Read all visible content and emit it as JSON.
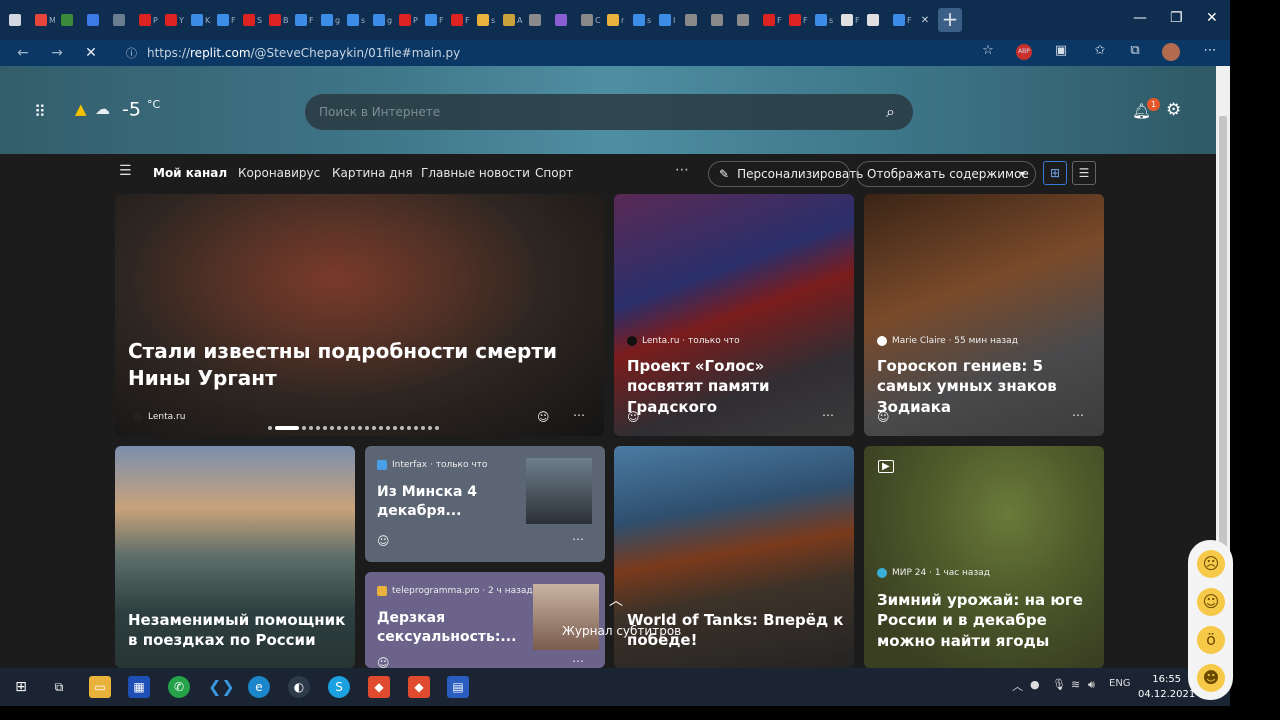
{
  "browser": {
    "tabs": [
      {
        "letter": "",
        "color": "#d0d7e0"
      },
      {
        "letter": "M",
        "color": "#e8453c"
      },
      {
        "letter": "",
        "color": "#3a8a3a"
      },
      {
        "letter": "",
        "color": "#3c7be6"
      },
      {
        "letter": "",
        "color": "#6a7d91"
      },
      {
        "letter": "P",
        "color": "#d22"
      },
      {
        "letter": "Y",
        "color": "#d22"
      },
      {
        "letter": "K",
        "color": "#3d8de8"
      },
      {
        "letter": "F",
        "color": "#3d8de8"
      },
      {
        "letter": "S",
        "color": "#d22"
      },
      {
        "letter": "B",
        "color": "#d22"
      },
      {
        "letter": "F",
        "color": "#3d8de8"
      },
      {
        "letter": "g",
        "color": "#3d8de8"
      },
      {
        "letter": "s",
        "color": "#3d8de8"
      },
      {
        "letter": "g",
        "color": "#3d8de8"
      },
      {
        "letter": "P",
        "color": "#d22"
      },
      {
        "letter": "F",
        "color": "#3d8de8"
      },
      {
        "letter": "F",
        "color": "#d22"
      },
      {
        "letter": "s",
        "color": "#e8b23c"
      },
      {
        "letter": "A",
        "color": "#c9a23c"
      },
      {
        "letter": "",
        "color": "#8a8a8a"
      },
      {
        "letter": "",
        "color": "#8b5fd1"
      },
      {
        "letter": "C",
        "color": "#8a8a8a"
      },
      {
        "letter": "r",
        "color": "#e8b23c"
      },
      {
        "letter": "s",
        "color": "#3d8de8"
      },
      {
        "letter": "I",
        "color": "#3d8de8"
      },
      {
        "letter": "",
        "color": "#8a8a8a"
      },
      {
        "letter": "",
        "color": "#8a8a8a"
      },
      {
        "letter": "",
        "color": "#8a8a8a"
      },
      {
        "letter": "F",
        "color": "#d22"
      },
      {
        "letter": "F",
        "color": "#d22"
      },
      {
        "letter": "s",
        "color": "#3d8de8"
      },
      {
        "letter": "F",
        "color": "#e0e0e0"
      },
      {
        "letter": "",
        "color": "#e0e0e0"
      },
      {
        "letter": "F",
        "color": "#3d8de8"
      }
    ],
    "url_prefix": "https://",
    "url_domain": "replit.com",
    "url_path": "/@SteveChepaykin/01file#main.py",
    "abp_label": "ABP"
  },
  "header": {
    "temperature": "-5",
    "temp_unit": "°C",
    "search_placeholder": "Поиск в Интернете",
    "notification_count": "1"
  },
  "nav": {
    "items": [
      {
        "label": "Мой канал"
      },
      {
        "label": "Коронавирус"
      },
      {
        "label": "Картина дня"
      },
      {
        "label": "Главные новости"
      },
      {
        "label": "Спорт"
      }
    ],
    "personalize_label": "Персонализировать",
    "display_label": "Отображать содержимое"
  },
  "cards": {
    "hero": {
      "title": "Стали известны подробности смерти Нины Ургант",
      "source": "Lenta.ru"
    },
    "c2": {
      "title": "Проект «Голос» посвятят памяти Градского",
      "source": "Lenta.ru · только что"
    },
    "c3": {
      "title": "Гороскоп гениев: 5 самых умных знаков Зодиака",
      "source": "Marie Claire · 55 мин назад"
    },
    "c4": {
      "title": "Незаменимый помощник в поездках по России"
    },
    "c5": {
      "title": "Из Минска 4 декабря...",
      "source": "Interfax · только что"
    },
    "c6": {
      "title": "Дерзкая сексуальность:...",
      "source": "teleprogramma.pro · 2 ч назад"
    },
    "c7": {
      "title": "World of Tanks: Вперёд к победе!"
    },
    "c8": {
      "title": "Зимний урожай: на юге России и в декабре можно найти ягоды",
      "source": "МИР 24 · 1 час назад"
    }
  },
  "caption": "Журнал субтитров",
  "taskbar": {
    "lang": "ENG",
    "time": "16:55",
    "date": "04.12.2021"
  }
}
